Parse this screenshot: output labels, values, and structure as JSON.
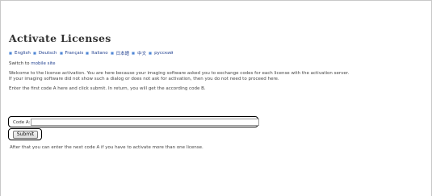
{
  "page": {
    "title": "Activate Licenses",
    "languages": [
      "English",
      "Deutsch",
      "Français",
      "Italiano",
      "日本語",
      "中文",
      "русский"
    ],
    "switch_prefix": "Switch to",
    "switch_link": "mobile site",
    "paragraph1_line1": "Welcome to the license activation. You are here because your imaging software asked you to exchange codes for each license with the activation server.",
    "paragraph1_line2": "If your imaging software did not show such a dialog or does not ask for activation, then you do not need to proceed here.",
    "paragraph2": "Enter the first code A here and click submit. In return, you will get the according code B.",
    "code_label": "Code A:",
    "code_value": "",
    "submit_label": "Submit",
    "after_text": "After that you can enter the next code A if you have to activate more than one license."
  }
}
